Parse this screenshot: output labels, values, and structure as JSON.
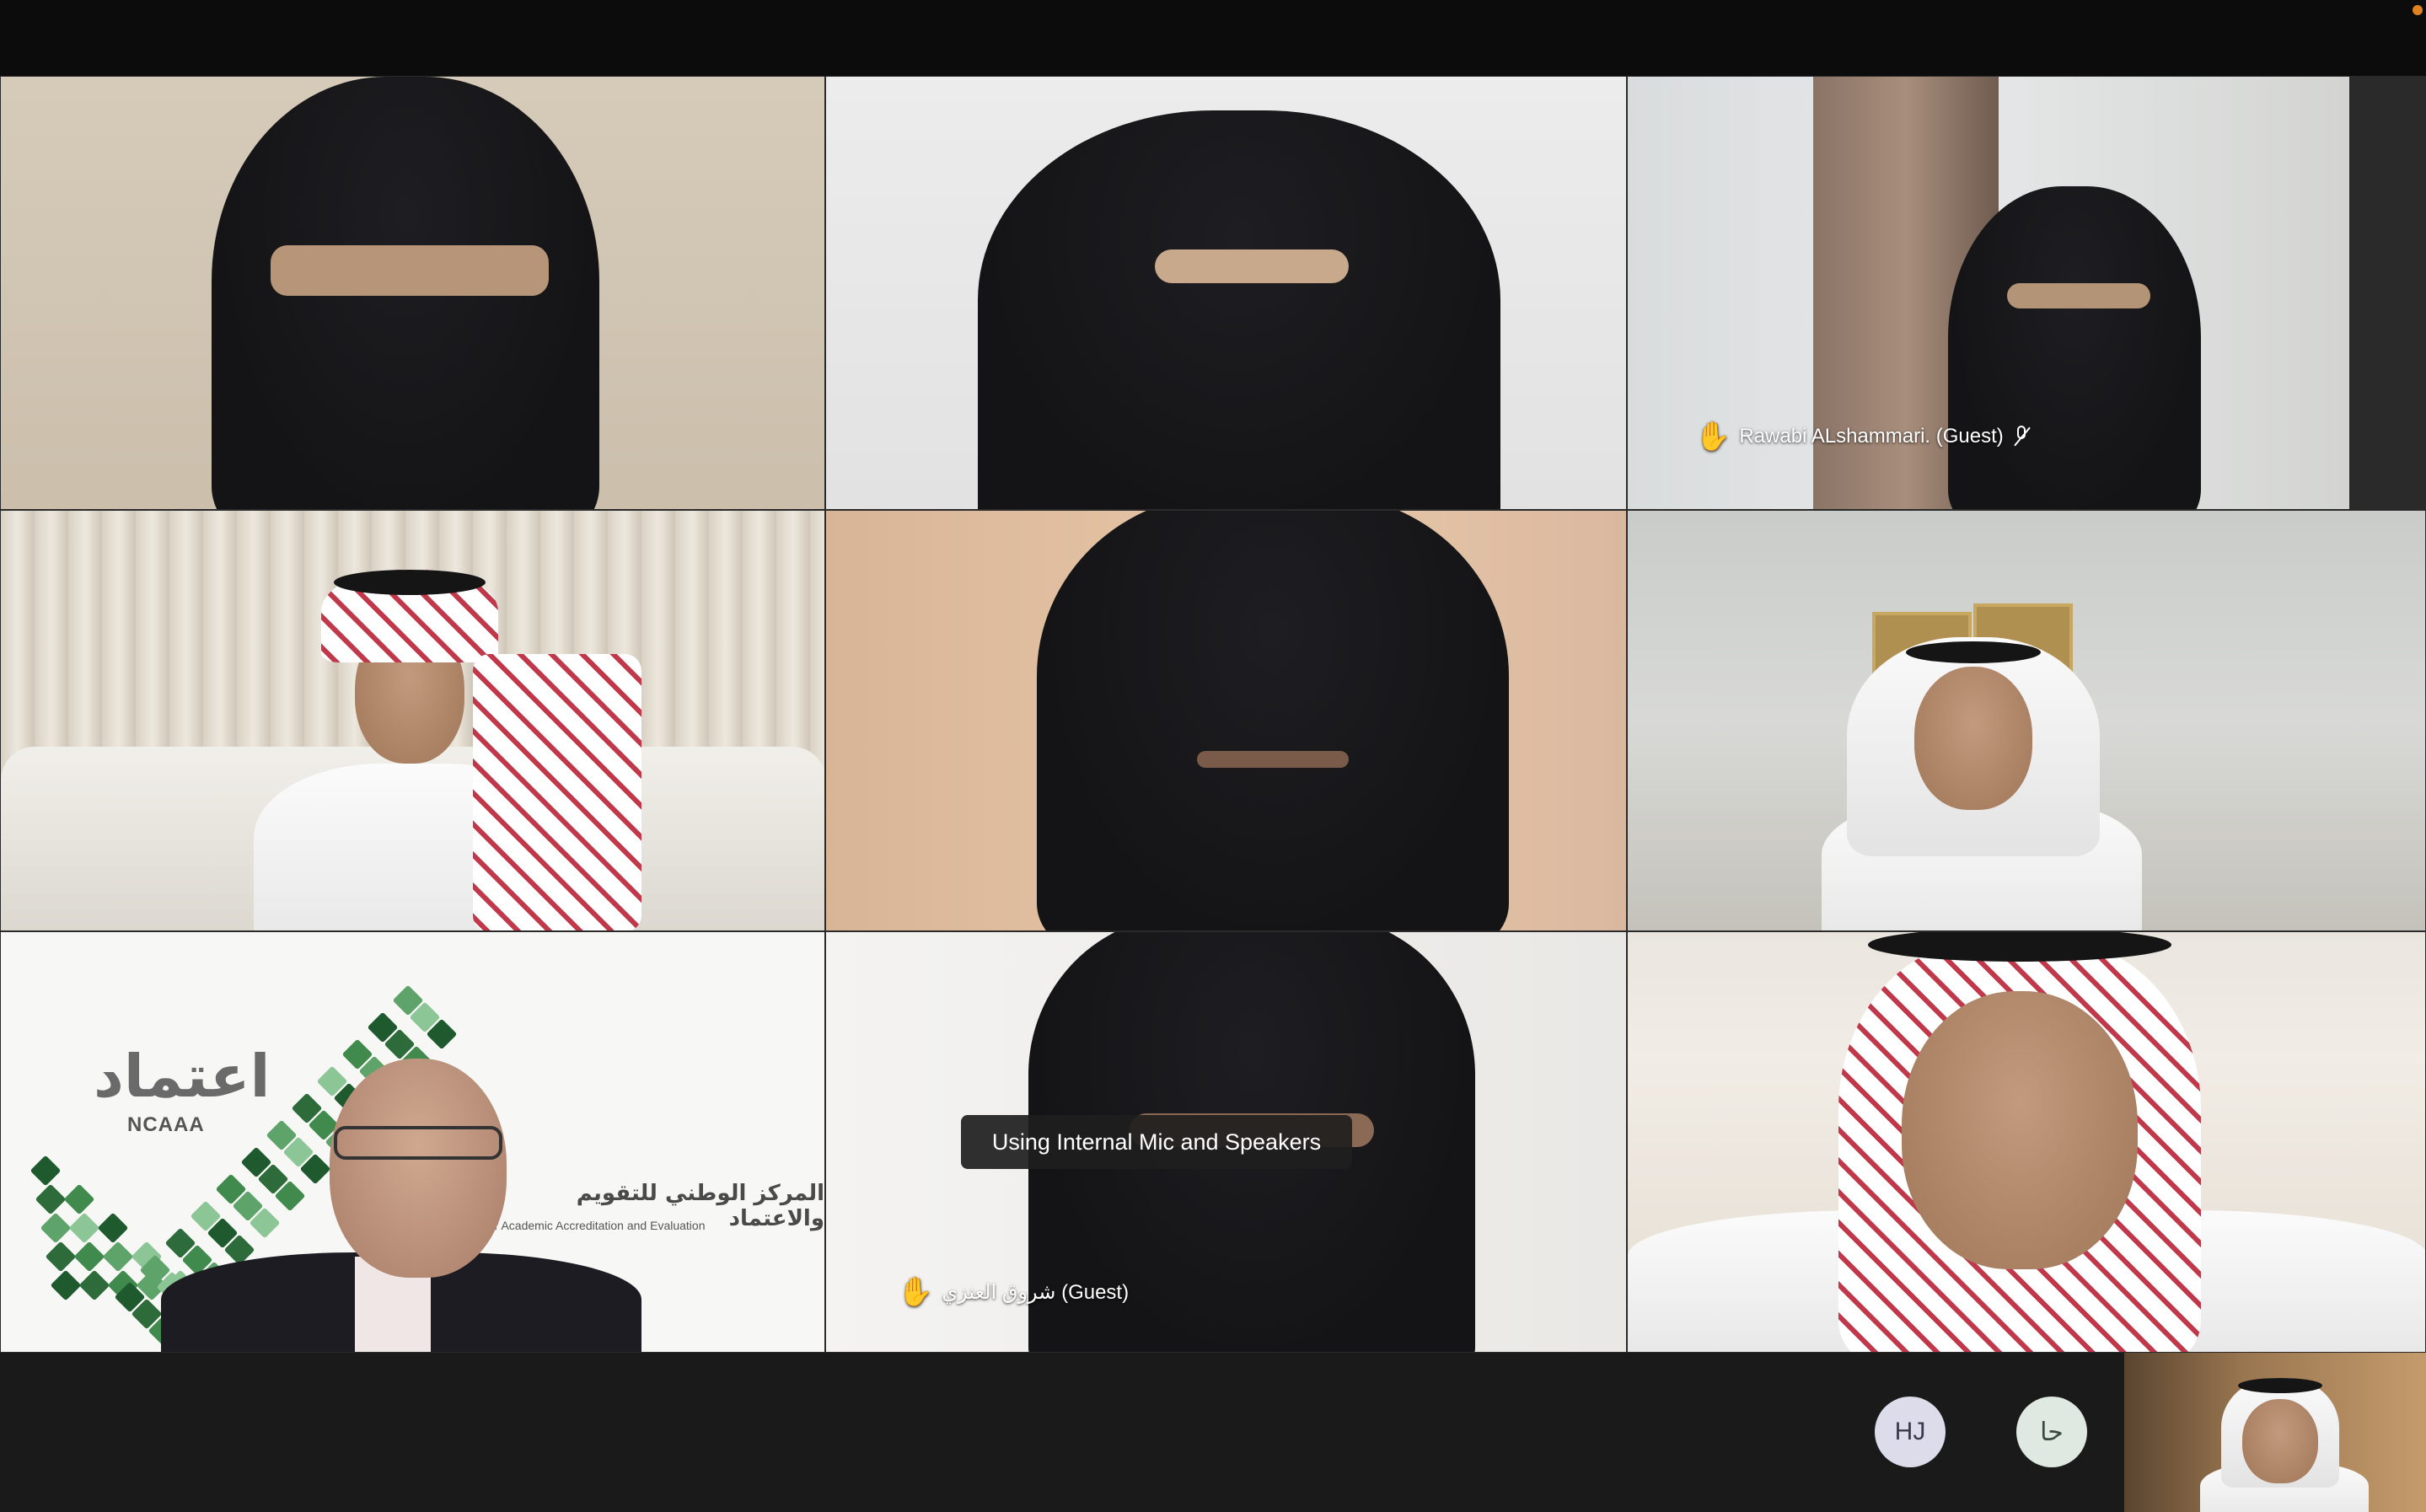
{
  "window": {
    "title": ""
  },
  "colors": {
    "background": "#121212",
    "topbar": "#0c0c0c",
    "bottom_strip": "#1a1a1a",
    "toast_bg": "#1e1e1e",
    "avatar_hj_bg": "#dcdcea",
    "avatar_ha_bg": "#dfe9e2",
    "logo_green": "#2e6b3a",
    "status_dot": "#e0821f"
  },
  "participants": [
    {
      "id": "p1",
      "name": "",
      "raised_hand": false,
      "muted": false
    },
    {
      "id": "p2",
      "name": "",
      "raised_hand": false,
      "muted": false
    },
    {
      "id": "p3",
      "name": "Rawabi ALshammari. (Guest)",
      "raised_hand": true,
      "muted": true,
      "hand_icon": "raised-hand-icon",
      "mic_icon": "mic-muted-icon"
    },
    {
      "id": "p4",
      "name": "",
      "raised_hand": false,
      "muted": false
    },
    {
      "id": "p5",
      "name": "",
      "raised_hand": false,
      "muted": false
    },
    {
      "id": "p6",
      "name": "",
      "raised_hand": false,
      "muted": false
    },
    {
      "id": "p7",
      "name": "",
      "raised_hand": false,
      "muted": false
    },
    {
      "id": "p8",
      "name": "شروق العنزي (Guest)",
      "raised_hand": true,
      "muted": false,
      "hand_icon": "raised-hand-icon"
    },
    {
      "id": "p9",
      "name": "",
      "raised_hand": false,
      "muted": false
    }
  ],
  "logo": {
    "arabic_short": "اعتماد",
    "english_short": "NCAAA",
    "arabic_full": "المركز الوطني للتقويم والاعتماد",
    "english_full": "for Academic Accreditation and Evaluation"
  },
  "toast": {
    "text": "Using Internal Mic and Speakers"
  },
  "bottom_strip": {
    "avatars": [
      {
        "initials": "HJ"
      },
      {
        "initials": "حا"
      }
    ]
  }
}
